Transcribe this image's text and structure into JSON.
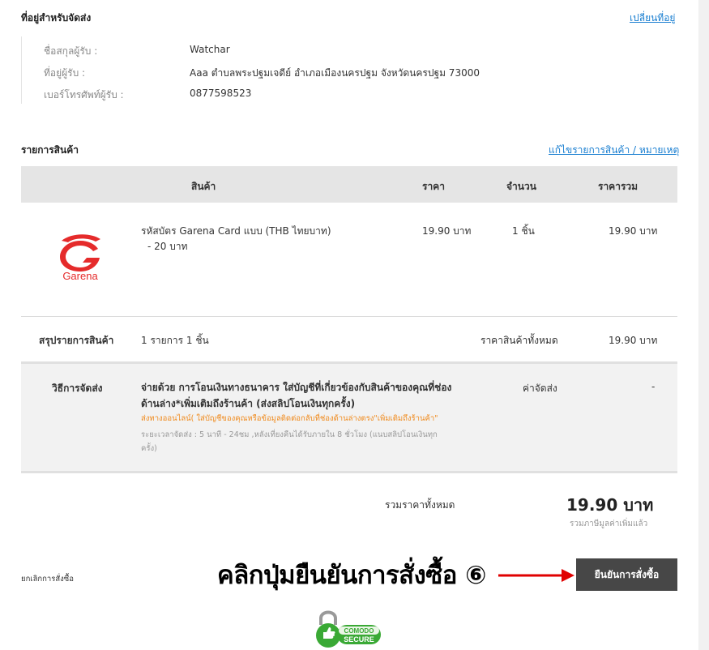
{
  "shipping_address": {
    "title": "ที่อยู่สำหรับจัดส่ง",
    "change_link": "เปลี่ยนที่อยู่",
    "name_label": "ชื่อสกุลผู้รับ :",
    "name_value": "Watchar",
    "address_label": "ที่อยู่ผู้รับ :",
    "address_value": "Aaa ตำบลพระปฐมเจดีย์ อำเภอเมืองนครปฐม จังหวัดนครปฐม 73000",
    "phone_label": "เบอร์โทรศัพท์ผู้รับ :",
    "phone_value": "0877598523"
  },
  "items": {
    "title": "รายการสินค้า",
    "edit_link": "แก้ไขรายการสินค้า / หมายเหตุ",
    "columns": [
      "สินค้า",
      "ราคา",
      "จำนวน",
      "ราคารวม"
    ],
    "rows": [
      {
        "logo_text": "Garena",
        "name_line1": "รหัสบัตร Garena Card แบบ (THB ไทยบาท)",
        "name_line2": "- 20 บาท",
        "price": "19.90 บาท",
        "qty": "1 ชิ้น",
        "total": "19.90 บาท"
      }
    ]
  },
  "summary": {
    "label": "สรุปรายการสินค้า",
    "count": "1 รายการ 1 ชิ้น",
    "subtotal_label": "ราคาสินค้าทั้งหมด",
    "subtotal_value": "19.90 บาท"
  },
  "shipping": {
    "label": "วิธีการจัดส่ง",
    "method_line1": "จ่ายด้วย การโอนเงินทางธนาคาร ใส่บัญชีที่เกี่ยวข้องกับสินค้าของคุณที่ช่อง",
    "method_line2": "ด้านล่าง*เพิ่มเติมถึงร้านค้า (ส่งสลิปโอนเงินทุกครั้ง)",
    "note": "ส่งทางออนไลน์( ใส่บัญชีของคุณหรือข้อมูลติดต่อกลับที่ช่องด้านล่างตรง\"เพิ่มเติมถึงร้านค้า\"",
    "duration_line1": "ระยะเวลาจัดส่ง :   5 นาที - 24ชม ,หลังเที่ยงคืนได้รับภายใน 8 ชั่วโมง (แนบสลิปโอนเงินทุก",
    "duration_line2": "ครั้ง)",
    "fee_label": "ค่าจัดส่ง",
    "fee_value": "-"
  },
  "total": {
    "label": "รวมราคาทั้งหมด",
    "value": "19.90 บาท",
    "vat_note": "รวมภาษีมูลค่าเพิ่มแล้ว"
  },
  "actions": {
    "cancel_label": "ยกเลิกการสั่งซื้อ",
    "confirm_label": "ยืนยันการสั่งซื้อ",
    "annotation": "คลิกปุ่มยืนยันการสั่งซื้อ ⑥"
  },
  "badge": {
    "line1": "COMODO",
    "line2": "SECURE"
  },
  "colors": {
    "accent_link": "#1a7fd1",
    "garena_red": "#e52b2b",
    "note_orange": "#f08a1c",
    "button_dark": "#474747",
    "arrow_red": "#e00000",
    "comodo_green": "#3aa935"
  }
}
